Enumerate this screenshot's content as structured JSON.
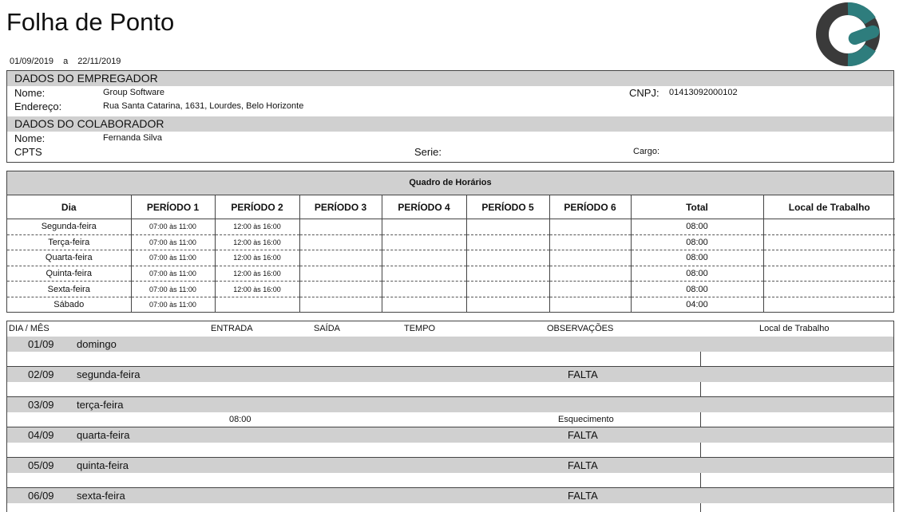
{
  "header": {
    "title": "Folha de Ponto",
    "period_start": "01/09/2019",
    "period_sep": "a",
    "period_end": "22/11/2019"
  },
  "brand": {
    "logo_colors": [
      "#3a3a3a",
      "#2e7d7d"
    ]
  },
  "employer": {
    "section_title": "DADOS DO EMPREGADOR",
    "name_label": "Nome:",
    "name": "Group Software",
    "address_label": "Endereço:",
    "address": "Rua Santa Catarina, 1631, Lourdes, Belo Horizonte",
    "cnpj_label": "CNPJ:",
    "cnpj": "01413092000102"
  },
  "employee": {
    "section_title": "DADOS DO COLABORADOR",
    "name_label": "Nome:",
    "name": "Fernanda Silva",
    "cpts_label": "CPTS",
    "serie_label": "Serie:",
    "cargo_label": "Cargo:"
  },
  "schedule": {
    "title": "Quadro de Horários",
    "columns": [
      "Dia",
      "PERÍODO 1",
      "PERÍODO 2",
      "PERÍODO 3",
      "PERÍODO 4",
      "PERÍODO 5",
      "PERÍODO 6",
      "Total",
      "Local de Trabalho"
    ],
    "rows": [
      [
        "Segunda-feira",
        "07:00 às 11:00",
        "12:00 às 16:00",
        "",
        "",
        "",
        "",
        "08:00",
        ""
      ],
      [
        "Terça-feira",
        "07:00 às 11:00",
        "12:00 às 16:00",
        "",
        "",
        "",
        "",
        "08:00",
        ""
      ],
      [
        "Quarta-feira",
        "07:00 às 11:00",
        "12:00 às 16:00",
        "",
        "",
        "",
        "",
        "08:00",
        ""
      ],
      [
        "Quinta-feira",
        "07:00 às 11:00",
        "12:00 às 16:00",
        "",
        "",
        "",
        "",
        "08:00",
        ""
      ],
      [
        "Sexta-feira",
        "07:00 às 11:00",
        "12:00 às 16:00",
        "",
        "",
        "",
        "",
        "08:00",
        ""
      ],
      [
        "Sábado",
        "07:00 às 11:00",
        "",
        "",
        "",
        "",
        "",
        "04:00",
        ""
      ]
    ]
  },
  "records": {
    "columns": {
      "dia_mes": "DIA / MÊS",
      "entrada": "ENTRADA",
      "saida": "SAÍDA",
      "tempo": "TEMPO",
      "observacoes": "OBSERVAÇÕES",
      "local": "Local de Trabalho"
    },
    "days": [
      {
        "date": "01/09",
        "weekday": "domingo",
        "obs_head": "",
        "entrada": "",
        "obs": ""
      },
      {
        "date": "02/09",
        "weekday": "segunda-feira",
        "obs_head": "FALTA",
        "entrada": "",
        "obs": ""
      },
      {
        "date": "03/09",
        "weekday": "terça-feira",
        "obs_head": "",
        "entrada": "08:00",
        "obs": "Esquecimento"
      },
      {
        "date": "04/09",
        "weekday": "quarta-feira",
        "obs_head": "FALTA",
        "entrada": "",
        "obs": ""
      },
      {
        "date": "05/09",
        "weekday": "quinta-feira",
        "obs_head": "FALTA",
        "entrada": "",
        "obs": ""
      },
      {
        "date": "06/09",
        "weekday": "sexta-feira",
        "obs_head": "FALTA",
        "entrada": "",
        "obs": ""
      }
    ]
  }
}
